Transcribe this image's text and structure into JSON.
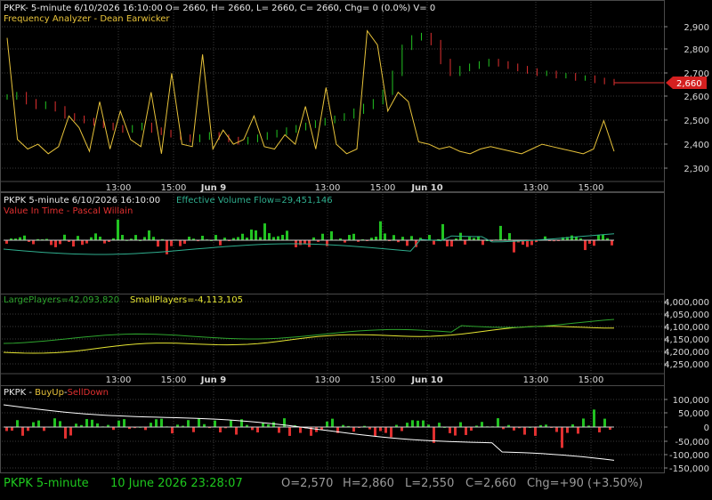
{
  "colors": {
    "background": "#000000",
    "grid": "#3a3a3a",
    "up": "#22c322",
    "down": "#e03030",
    "analyzer": "#e8c33a",
    "volume_flow": "#2fae8e",
    "large": "#e6e632",
    "small": "#2ea52e",
    "buyup_line": "#ffffff",
    "title_white": "#e8e8e8",
    "title_gold": "#e8c33a",
    "title_red": "#e03030",
    "title_teal": "#2fae8e"
  },
  "panel1": {
    "header": "PKPK- 5-minute 6/10/2026 16:10:00 O= 2660, H= 2660, L= 2660, C= 2660, Chg= 0 (0.0%) V= 0",
    "subtitle": "Frequency Analyzer - Dean Earwicker",
    "y_ticks": [
      "2,900",
      "2,800",
      "2,700",
      "2,600",
      "2,500",
      "2,400",
      "2,300"
    ],
    "price_marker": "2,660"
  },
  "panel2": {
    "header_left": "PKPK 5-minute  6/10/2026 16:10:00",
    "header_right": "Effective Volume Flow=29,451,146",
    "subtitle": "Value In Time - Pascal Willain"
  },
  "panel3": {
    "large_label": "LargePlayers=42,093,820",
    "small_label": "SmallPlayers=-4,113,105",
    "y_ticks": [
      "4,000,000",
      "4,050,000",
      "4,100,000",
      "4,150,000",
      "4,200,000",
      "4,250,000"
    ]
  },
  "panel4": {
    "title_symbol": "PKPK",
    "title_sep1": " - ",
    "title_up": "BuyUp",
    "title_sep2": "-",
    "title_down": "SellDown",
    "y_ticks": [
      "100,000",
      "50,000",
      "0",
      "-50,000",
      "-100,000",
      "-150,000"
    ]
  },
  "x_axis": {
    "labels": [
      "13:00",
      "15:00",
      "Jun 9",
      "13:00",
      "15:00",
      "Jun 10",
      "13:00",
      "15:00"
    ]
  },
  "status": {
    "symbol": "PKPK  5-minute",
    "datetime": "10 June 2026 23:28:07",
    "open": "O=2,570",
    "high": "H=2,860",
    "low": "L=2,550",
    "close": "C=2,660",
    "change": "Chg=+90 (+3.50%)"
  },
  "chart_data": [
    {
      "type": "line",
      "title": "Frequency Analyzer - Dean Earwicker",
      "series_note": "price candles (5-minute) with frequency analyzer overlay",
      "ylim": [
        2250,
        2950
      ],
      "price_series": [
        {
          "name": "close",
          "values": [
            2600,
            2610,
            2580,
            2560,
            2570,
            2550,
            2520,
            2510,
            2500,
            2490,
            2480,
            2470,
            2460,
            2470,
            2480,
            2460,
            2450,
            2440,
            2430,
            2420,
            2430,
            2440,
            2430,
            2420,
            2410,
            2420,
            2430,
            2440,
            2450,
            2460,
            2470,
            2480,
            2490,
            2500,
            2510,
            2520,
            2540,
            2560,
            2580,
            2620,
            2700,
            2810,
            2850,
            2860,
            2830,
            2750,
            2700,
            2720,
            2730,
            2740,
            2750,
            2740,
            2730,
            2720,
            2710,
            2700,
            2700,
            2690,
            2690,
            2680,
            2680,
            2670,
            2665,
            2660
          ]
        }
      ],
      "analyzer_values": [
        2850,
        2420,
        2380,
        2400,
        2360,
        2390,
        2520,
        2470,
        2370,
        2580,
        2380,
        2540,
        2420,
        2390,
        2620,
        2360,
        2700,
        2400,
        2390,
        2780,
        2380,
        2460,
        2400,
        2420,
        2520,
        2390,
        2380,
        2440,
        2400,
        2560,
        2380,
        2640,
        2400,
        2360,
        2380,
        2880,
        2820,
        2540,
        2620,
        2580,
        2410,
        2400,
        2380,
        2390,
        2370,
        2360,
        2380,
        2390,
        2380,
        2370,
        2360,
        2380,
        2400,
        2390,
        2380,
        2370,
        2360,
        2380,
        2500,
        2370
      ],
      "current_price": 2660
    },
    {
      "type": "bar",
      "title": "Value In Time - Pascal Willain",
      "series": [
        {
          "name": "Effective Volume Flow",
          "last": 29451146
        }
      ]
    },
    {
      "type": "line",
      "series": [
        {
          "name": "LargePlayers",
          "last": 42093820
        },
        {
          "name": "SmallPlayers",
          "last": -4113105
        }
      ],
      "ylim": [
        4000000,
        4250000
      ]
    },
    {
      "type": "bar",
      "title": "PKPK - BuyUp-SellDown",
      "ylim": [
        -150000,
        100000
      ]
    }
  ]
}
